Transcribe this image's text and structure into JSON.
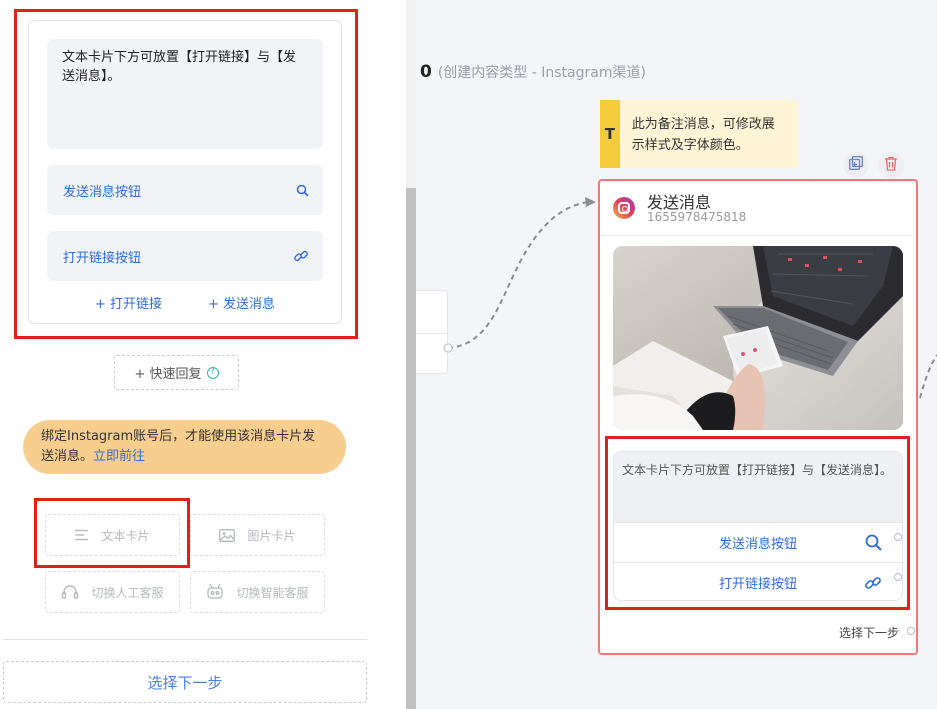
{
  "editor": {
    "text": "文本卡片下方可放置【打开链接】与【发送消息】。",
    "buttons": [
      {
        "label": "发送消息按钮",
        "icon": "search-icon"
      },
      {
        "label": "打开链接按钮",
        "icon": "link-icon"
      }
    ],
    "add_link": "+ 打开链接",
    "add_message": "+ 发送消息"
  },
  "quick_reply": {
    "label": "+ 快速回复",
    "help": "?"
  },
  "notice": {
    "text": "绑定Instagram账号后，才能使用该消息卡片发送消息。",
    "link": "立即前往"
  },
  "card_types": [
    {
      "label": "文本卡片",
      "icon": "text-lines-icon"
    },
    {
      "label": "图片卡片",
      "icon": "image-icon"
    },
    {
      "label": "切换人工客服",
      "icon": "headset-icon"
    },
    {
      "label": "切换智能客服",
      "icon": "robot-icon"
    }
  ],
  "next_step_button": "选择下一步",
  "canvas": {
    "title_num": "0",
    "title_desc": "(创建内容类型 - Instagram渠道)"
  },
  "note": {
    "badge": "T",
    "text": "此为备注消息，可修改展示样式及字体颜色。",
    "color": "#f3cc3c"
  },
  "node": {
    "title": "发送消息",
    "id": "1655978475818",
    "card_text": "文本卡片下方可放置【打开链接】与【发送消息】。",
    "buttons": [
      {
        "label": "发送消息按钮",
        "icon": "search-icon"
      },
      {
        "label": "打开链接按钮",
        "icon": "link-icon"
      }
    ],
    "next_label": "选择下一步"
  },
  "colors": {
    "accent": "#2f6bd8",
    "highlight": "#e0201b",
    "node_border": "#f07878",
    "notice_bg": "#f8ce8f"
  }
}
